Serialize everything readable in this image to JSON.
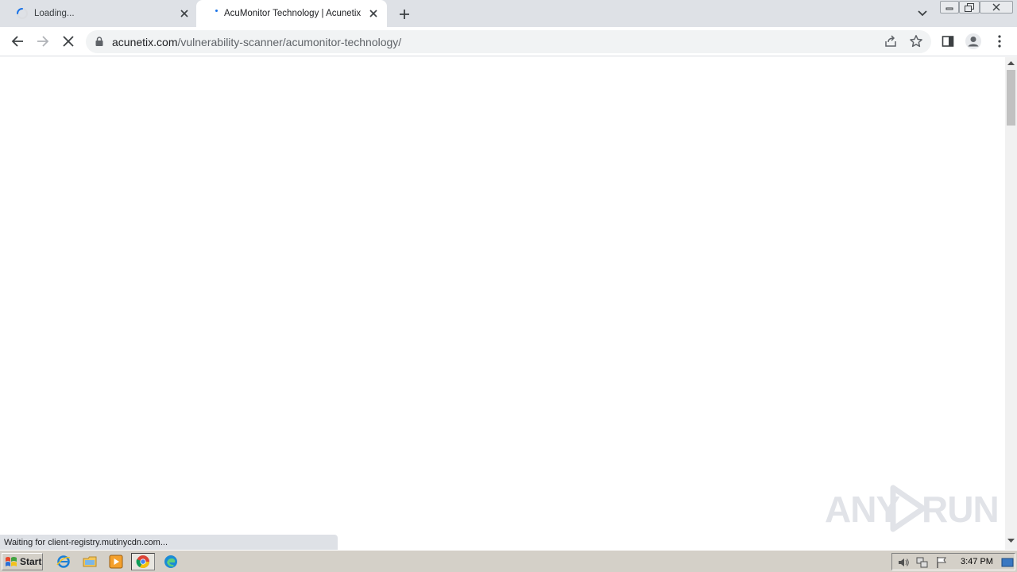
{
  "browser": {
    "tabs": [
      {
        "title": "Loading...",
        "state": "loading",
        "close_label": "close-tab"
      },
      {
        "title": "AcuMonitor Technology | Acunetix",
        "state": "active"
      }
    ],
    "address": {
      "host": "acunetix.com",
      "path": "/vulnerability-scanner/acumonitor-technology/"
    },
    "status_text": "Waiting for client-registry.mutinycdn.com...",
    "colors": {
      "tabstrip": "#dee1e6",
      "accent": "#1a73e8",
      "omnibox": "#f1f3f4"
    }
  },
  "watermark": {
    "text_left": "ANY",
    "text_right": "RUN"
  },
  "taskbar": {
    "start_label": "Start",
    "clock": "3:47 PM",
    "quick_launch": [
      "internet-explorer-icon",
      "file-explorer-icon",
      "media-player-icon",
      "chrome-icon",
      "edge-icon"
    ]
  }
}
